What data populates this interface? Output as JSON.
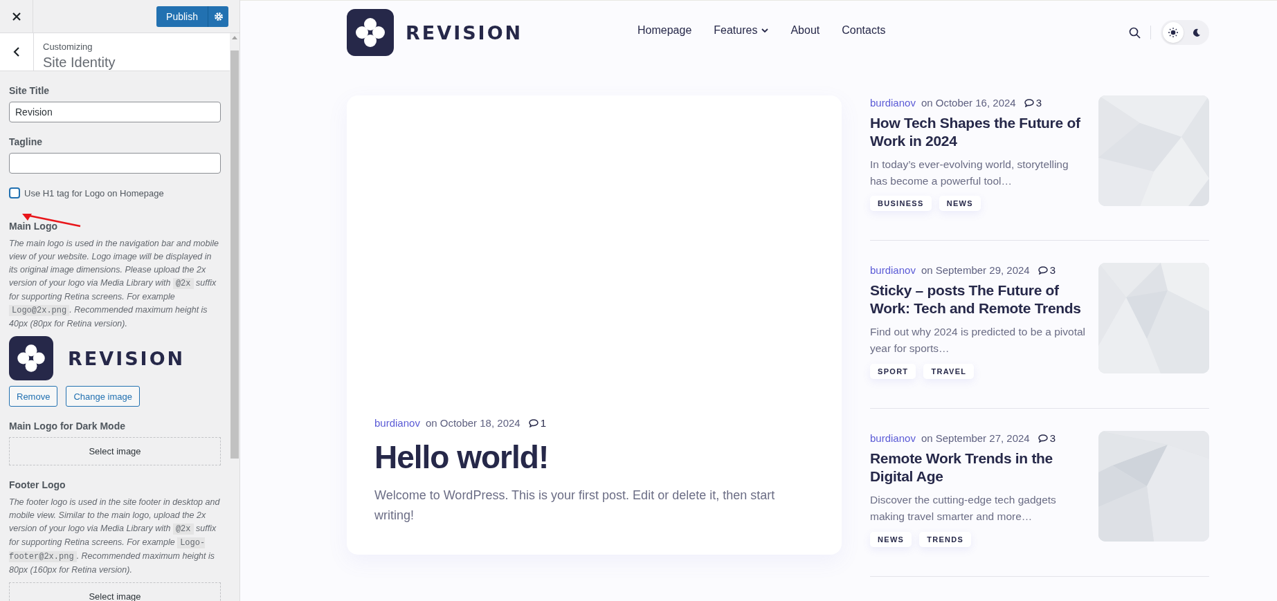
{
  "customizer": {
    "publish_label": "Publish",
    "breadcrumb": "Customizing",
    "section_title": "Site Identity",
    "controls": [
      {
        "kind": "text",
        "label": "Site Title",
        "value": "Revision"
      },
      {
        "kind": "text",
        "label": "Tagline"
      },
      {
        "kind": "checkbox",
        "label": "Use H1 tag for Logo on Homepage",
        "checked": false
      },
      {
        "label": "Main Logo",
        "description": [
          {
            "kind": "text",
            "text": "The main logo is used in the navigation bar and mobile view of your website. Logo image will be displayed in its original image dimensions. Please upload the 2x version of your logo via Media Library with "
          },
          {
            "kind": "code",
            "text": "@2x"
          },
          {
            "kind": "text",
            "text": " suffix for supporting Retina screens. For example "
          },
          {
            "kind": "code",
            "text": "Logo@2x.png"
          },
          {
            "kind": "text",
            "text": ". Recommended maximum height is 40px (80px for Retina version)."
          }
        ],
        "logo_text": "REVISION",
        "buttons": [
          "Remove",
          "Change image"
        ]
      },
      {
        "kind": "upload",
        "label": "Main Logo for Dark Mode",
        "button": "Select image"
      },
      {
        "kind": "upload",
        "label": "Footer Logo",
        "description": [
          {
            "kind": "text",
            "text": "The footer logo is used in the site footer in desktop and mobile view. Similar to the main logo, upload the 2x version of your logo via Media Library with "
          },
          {
            "kind": "code",
            "text": "@2x"
          },
          {
            "kind": "text",
            "text": " suffix for supporting Retina screens. For example "
          },
          {
            "kind": "code",
            "text": "Logo-footer@2x.png"
          },
          {
            "kind": "text",
            "text": ". Recommended maximum height is 80px (160px for Retina version)."
          }
        ],
        "button": "Select image"
      }
    ]
  },
  "site": {
    "logo_text": "REVISION",
    "nav": [
      {
        "label": "Homepage",
        "dropdown": false
      },
      {
        "label": "Features",
        "dropdown": true
      },
      {
        "label": "About",
        "dropdown": false
      },
      {
        "label": "Contacts",
        "dropdown": false
      }
    ],
    "theme_toggle": [
      {
        "kind": "light",
        "selected": true
      },
      {
        "kind": "dark",
        "selected": false
      }
    ],
    "featured": {
      "author": "burdianov",
      "date": "on October 18, 2024",
      "comments": "1",
      "title": "Hello world!",
      "excerpt": "Welcome to WordPress. This is your first post. Edit or delete it, then start writing!"
    },
    "posts": [
      {
        "author": "burdianov",
        "date": "on October 16, 2024",
        "comments": "3",
        "title": "How Tech Shapes the Future of Work in 2024",
        "excerpt": "In today’s ever-evolving world, storytelling has become a powerful tool…",
        "tags": [
          "BUSINESS",
          "NEWS"
        ]
      },
      {
        "author": "burdianov",
        "date": "on September 29, 2024",
        "comments": "3",
        "title": "Sticky – posts The Future of Work: Tech and Remote Trends",
        "excerpt": "Find out why 2024 is predicted to be a pivotal year for sports…",
        "tags": [
          "SPORT",
          "TRAVEL"
        ]
      },
      {
        "author": "burdianov",
        "date": "on September 27, 2024",
        "comments": "3",
        "title": "Remote Work Trends in the Digital Age",
        "excerpt": "Discover the cutting-edge tech gadgets making travel smarter and more…",
        "tags": [
          "NEWS",
          "TRENDS"
        ]
      }
    ]
  }
}
